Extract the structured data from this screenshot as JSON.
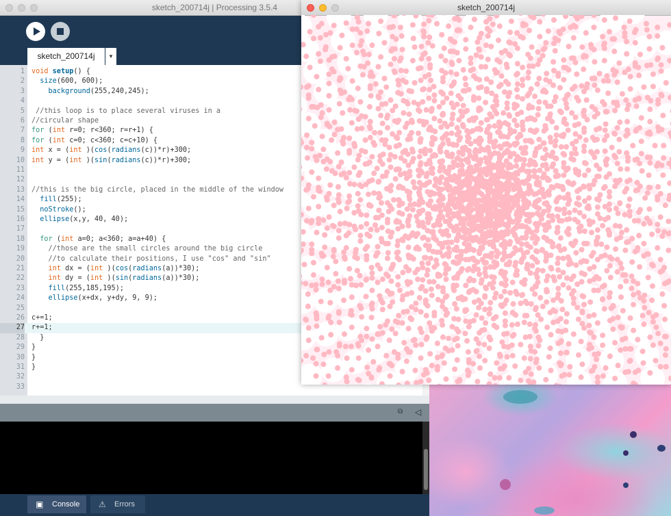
{
  "ide": {
    "window_title": "sketch_200714j | Processing 3.5.4",
    "tab_label": "sketch_200714j",
    "tab_menu_glyph": "▾",
    "run_icon": "play-icon",
    "stop_icon": "stop-icon",
    "code": [
      {
        "n": "1",
        "segs": [
          [
            "t",
            "void "
          ],
          [
            "b",
            "setup"
          ],
          [
            "",
            "() {"
          ]
        ]
      },
      {
        "n": "2",
        "segs": [
          [
            "",
            "  "
          ],
          [
            "f",
            "size"
          ],
          [
            "",
            "(600, 600);"
          ]
        ]
      },
      {
        "n": "3",
        "segs": [
          [
            "",
            "    "
          ],
          [
            "f",
            "background"
          ],
          [
            "",
            "(255,240,245);"
          ]
        ]
      },
      {
        "n": "4",
        "segs": []
      },
      {
        "n": "5",
        "segs": [
          [
            "c",
            " //this loop is to place several viruses in a"
          ]
        ]
      },
      {
        "n": "6",
        "segs": [
          [
            "c",
            "//circular shape"
          ]
        ]
      },
      {
        "n": "7",
        "segs": [
          [
            "k",
            "for"
          ],
          [
            "",
            " ("
          ],
          [
            "t",
            "int"
          ],
          [
            "",
            " r=0; r<360; r=r+1) {"
          ]
        ]
      },
      {
        "n": "8",
        "segs": [
          [
            "k",
            "for"
          ],
          [
            "",
            " ("
          ],
          [
            "t",
            "int"
          ],
          [
            "",
            " c=0; c<360; c=c+10) {"
          ]
        ]
      },
      {
        "n": "9",
        "segs": [
          [
            "t",
            "int"
          ],
          [
            "",
            " x = ("
          ],
          [
            "t",
            "int"
          ],
          [
            "",
            " )("
          ],
          [
            "f",
            "cos"
          ],
          [
            "",
            "("
          ],
          [
            "f",
            "radians"
          ],
          [
            "",
            "(c))*r)+300;"
          ]
        ]
      },
      {
        "n": "10",
        "segs": [
          [
            "t",
            "int"
          ],
          [
            "",
            " y = ("
          ],
          [
            "t",
            "int"
          ],
          [
            "",
            " )("
          ],
          [
            "f",
            "sin"
          ],
          [
            "",
            "("
          ],
          [
            "f",
            "radians"
          ],
          [
            "",
            "(c))*r)+300;"
          ]
        ]
      },
      {
        "n": "11",
        "segs": []
      },
      {
        "n": "12",
        "segs": []
      },
      {
        "n": "13",
        "segs": [
          [
            "c",
            "//this is the big circle, placed in the middle of the window"
          ]
        ]
      },
      {
        "n": "14",
        "segs": [
          [
            "",
            "  "
          ],
          [
            "f",
            "fill"
          ],
          [
            "",
            "(255);"
          ]
        ]
      },
      {
        "n": "15",
        "segs": [
          [
            "",
            "  "
          ],
          [
            "f",
            "noStroke"
          ],
          [
            "",
            "();"
          ]
        ]
      },
      {
        "n": "16",
        "segs": [
          [
            "",
            "  "
          ],
          [
            "f",
            "ellipse"
          ],
          [
            "",
            "(x,y, 40, 40);"
          ]
        ]
      },
      {
        "n": "17",
        "segs": []
      },
      {
        "n": "18",
        "segs": [
          [
            "",
            "  "
          ],
          [
            "k",
            "for"
          ],
          [
            "",
            " ("
          ],
          [
            "t",
            "int"
          ],
          [
            "",
            " a=0; a<360; a=a+40) {"
          ]
        ]
      },
      {
        "n": "19",
        "segs": [
          [
            "c",
            "    //those are the small circles around the big circle"
          ]
        ]
      },
      {
        "n": "20",
        "segs": [
          [
            "c",
            "    //to calculate their positions, I use \"cos\" and \"sin\""
          ]
        ]
      },
      {
        "n": "21",
        "segs": [
          [
            "",
            "    "
          ],
          [
            "t",
            "int"
          ],
          [
            "",
            " dx = ("
          ],
          [
            "t",
            "int"
          ],
          [
            "",
            " )("
          ],
          [
            "f",
            "cos"
          ],
          [
            "",
            "("
          ],
          [
            "f",
            "radians"
          ],
          [
            "",
            "(a))*30);"
          ]
        ]
      },
      {
        "n": "22",
        "segs": [
          [
            "",
            "    "
          ],
          [
            "t",
            "int"
          ],
          [
            "",
            " dy = ("
          ],
          [
            "t",
            "int"
          ],
          [
            "",
            " )("
          ],
          [
            "f",
            "sin"
          ],
          [
            "",
            "("
          ],
          [
            "f",
            "radians"
          ],
          [
            "",
            "(a))*30);"
          ]
        ]
      },
      {
        "n": "23",
        "segs": [
          [
            "",
            "    "
          ],
          [
            "f",
            "fill"
          ],
          [
            "",
            "(255,185,195);"
          ]
        ]
      },
      {
        "n": "24",
        "segs": [
          [
            "",
            "    "
          ],
          [
            "f",
            "ellipse"
          ],
          [
            "",
            "(x+dx, y+dy, 9, 9);"
          ]
        ]
      },
      {
        "n": "25",
        "segs": []
      },
      {
        "n": "26",
        "segs": [
          [
            "",
            "c+=1;"
          ]
        ]
      },
      {
        "n": "27",
        "segs": [
          [
            "",
            "r+=1;"
          ]
        ],
        "highlight": true
      },
      {
        "n": "28",
        "segs": [
          [
            "",
            "  }"
          ]
        ]
      },
      {
        "n": "29",
        "segs": [
          [
            "",
            "}"
          ]
        ]
      },
      {
        "n": "30",
        "segs": [
          [
            "",
            "}"
          ]
        ]
      },
      {
        "n": "31",
        "segs": [
          [
            "",
            "}"
          ]
        ]
      },
      {
        "n": "32",
        "segs": []
      },
      {
        "n": "33",
        "segs": []
      }
    ],
    "footer_tabs": [
      {
        "label": "Console",
        "icon": "console-icon",
        "active": true
      },
      {
        "label": "Errors",
        "icon": "warning-icon",
        "active": false
      }
    ]
  },
  "sketch_window": {
    "title": "sketch_200714j",
    "background_color": "#ffeff5",
    "big_circle_color": "#ffffff",
    "small_circle_color": "#ffb9c3"
  }
}
